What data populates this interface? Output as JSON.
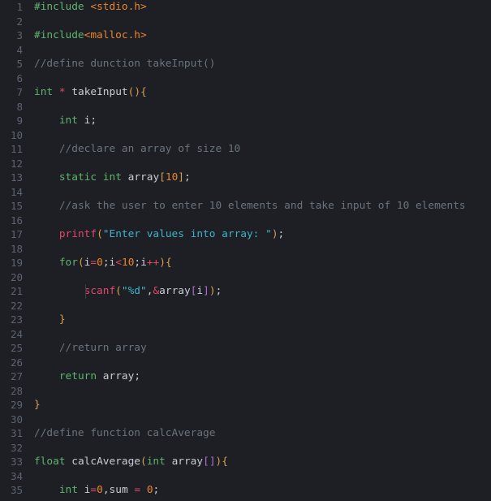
{
  "editor": {
    "language": "C",
    "background_color": "#1e1f25",
    "gutter_text_color": "#5c6370",
    "default_text_color": "#c8ccd4",
    "first_visible_line": 1,
    "last_visible_line": 35,
    "line_numbers": [
      "1",
      "2",
      "3",
      "4",
      "5",
      "6",
      "7",
      "8",
      "9",
      "10",
      "11",
      "12",
      "13",
      "14",
      "15",
      "16",
      "17",
      "18",
      "19",
      "20",
      "21",
      "22",
      "23",
      "24",
      "25",
      "26",
      "27",
      "28",
      "29",
      "30",
      "31",
      "32",
      "33",
      "34",
      "35"
    ],
    "plain_text": [
      "#include <stdio.h>",
      "",
      "#include<malloc.h>",
      "",
      "//define dunction takeInput()",
      "",
      "int * takeInput(){",
      "",
      "    int i;",
      "",
      "    //declare an array of size 10",
      "",
      "    static int array[10];",
      "",
      "    //ask the user to enter 10 elements and take input of 10 elements",
      "",
      "    printf(\"Enter values into array: \");",
      "",
      "    for(i=0;i<10;i++){",
      "",
      "        scanf(\"%d\",&array[i]);",
      "",
      "    }",
      "",
      "    //return array",
      "",
      "    return array;",
      "",
      "}",
      "",
      "//define function calcAverage",
      "",
      "float calcAverage(int array[]){",
      "",
      "    int i=0,sum = 0;"
    ],
    "lines": [
      {
        "n": "1",
        "tokens": [
          {
            "t": "#include",
            "c": "preproc"
          },
          {
            "t": " ",
            "c": "punct"
          },
          {
            "t": "<stdio.h>",
            "c": "header"
          }
        ]
      },
      {
        "n": "2",
        "tokens": []
      },
      {
        "n": "3",
        "tokens": [
          {
            "t": "#include",
            "c": "preproc"
          },
          {
            "t": "<malloc.h>",
            "c": "header"
          }
        ]
      },
      {
        "n": "4",
        "tokens": []
      },
      {
        "n": "5",
        "tokens": [
          {
            "t": "//define dunction takeInput()",
            "c": "comment"
          }
        ]
      },
      {
        "n": "6",
        "tokens": []
      },
      {
        "n": "7",
        "tokens": [
          {
            "t": "int",
            "c": "keyword"
          },
          {
            "t": " ",
            "c": "punct"
          },
          {
            "t": "*",
            "c": "op"
          },
          {
            "t": " ",
            "c": "punct"
          },
          {
            "t": "takeInput",
            "c": "ident"
          },
          {
            "t": "(",
            "c": "br1"
          },
          {
            "t": ")",
            "c": "br1"
          },
          {
            "t": "{",
            "c": "br1"
          }
        ]
      },
      {
        "n": "8",
        "tokens": []
      },
      {
        "n": "9",
        "tokens": [
          {
            "t": "    ",
            "c": "punct"
          },
          {
            "t": "int",
            "c": "keyword"
          },
          {
            "t": " ",
            "c": "punct"
          },
          {
            "t": "i",
            "c": "ident"
          },
          {
            "t": ";",
            "c": "punct"
          }
        ]
      },
      {
        "n": "10",
        "tokens": []
      },
      {
        "n": "11",
        "tokens": [
          {
            "t": "    ",
            "c": "punct"
          },
          {
            "t": "//declare an array of size 10",
            "c": "comment"
          }
        ]
      },
      {
        "n": "12",
        "tokens": []
      },
      {
        "n": "13",
        "tokens": [
          {
            "t": "    ",
            "c": "punct"
          },
          {
            "t": "static",
            "c": "keyword"
          },
          {
            "t": " ",
            "c": "punct"
          },
          {
            "t": "int",
            "c": "keyword"
          },
          {
            "t": " ",
            "c": "punct"
          },
          {
            "t": "array",
            "c": "ident"
          },
          {
            "t": "[",
            "c": "br1"
          },
          {
            "t": "10",
            "c": "number"
          },
          {
            "t": "]",
            "c": "br1"
          },
          {
            "t": ";",
            "c": "punct"
          }
        ]
      },
      {
        "n": "14",
        "tokens": []
      },
      {
        "n": "15",
        "tokens": [
          {
            "t": "    ",
            "c": "punct"
          },
          {
            "t": "//ask the user to enter 10 elements and take input of 10 elements",
            "c": "comment"
          }
        ]
      },
      {
        "n": "16",
        "tokens": []
      },
      {
        "n": "17",
        "tokens": [
          {
            "t": "    ",
            "c": "punct"
          },
          {
            "t": "printf",
            "c": "func"
          },
          {
            "t": "(",
            "c": "br1"
          },
          {
            "t": "\"Enter values into array: \"",
            "c": "string"
          },
          {
            "t": ")",
            "c": "br1"
          },
          {
            "t": ";",
            "c": "punct"
          }
        ]
      },
      {
        "n": "18",
        "tokens": []
      },
      {
        "n": "19",
        "tokens": [
          {
            "t": "    ",
            "c": "punct"
          },
          {
            "t": "for",
            "c": "keyword"
          },
          {
            "t": "(",
            "c": "br1"
          },
          {
            "t": "i",
            "c": "ident"
          },
          {
            "t": "=",
            "c": "op"
          },
          {
            "t": "0",
            "c": "number"
          },
          {
            "t": ";",
            "c": "punct"
          },
          {
            "t": "i",
            "c": "ident"
          },
          {
            "t": "<",
            "c": "op"
          },
          {
            "t": "10",
            "c": "number"
          },
          {
            "t": ";",
            "c": "punct"
          },
          {
            "t": "i",
            "c": "ident"
          },
          {
            "t": "++",
            "c": "op"
          },
          {
            "t": ")",
            "c": "br1"
          },
          {
            "t": "{",
            "c": "br1"
          }
        ]
      },
      {
        "n": "20",
        "tokens": []
      },
      {
        "n": "21",
        "tokens": [
          {
            "t": "        ",
            "c": "punct"
          },
          {
            "t": "scanf",
            "c": "func"
          },
          {
            "t": "(",
            "c": "br1"
          },
          {
            "t": "\"%d\"",
            "c": "string"
          },
          {
            "t": ",",
            "c": "punct"
          },
          {
            "t": "&",
            "c": "op"
          },
          {
            "t": "array",
            "c": "ident"
          },
          {
            "t": "[",
            "c": "br2"
          },
          {
            "t": "i",
            "c": "ident"
          },
          {
            "t": "]",
            "c": "br2"
          },
          {
            "t": ")",
            "c": "br1"
          },
          {
            "t": ";",
            "c": "punct"
          }
        ]
      },
      {
        "n": "22",
        "tokens": []
      },
      {
        "n": "23",
        "tokens": [
          {
            "t": "    ",
            "c": "punct"
          },
          {
            "t": "}",
            "c": "br1"
          }
        ]
      },
      {
        "n": "24",
        "tokens": []
      },
      {
        "n": "25",
        "tokens": [
          {
            "t": "    ",
            "c": "punct"
          },
          {
            "t": "//return array",
            "c": "comment"
          }
        ]
      },
      {
        "n": "26",
        "tokens": []
      },
      {
        "n": "27",
        "tokens": [
          {
            "t": "    ",
            "c": "punct"
          },
          {
            "t": "return",
            "c": "keyword"
          },
          {
            "t": " ",
            "c": "punct"
          },
          {
            "t": "array",
            "c": "ident"
          },
          {
            "t": ";",
            "c": "punct"
          }
        ]
      },
      {
        "n": "28",
        "tokens": []
      },
      {
        "n": "29",
        "tokens": [
          {
            "t": "}",
            "c": "br1"
          }
        ]
      },
      {
        "n": "30",
        "tokens": []
      },
      {
        "n": "31",
        "tokens": [
          {
            "t": "//define function calcAverage",
            "c": "comment"
          }
        ]
      },
      {
        "n": "32",
        "tokens": []
      },
      {
        "n": "33",
        "tokens": [
          {
            "t": "float",
            "c": "keyword"
          },
          {
            "t": " ",
            "c": "punct"
          },
          {
            "t": "calcAverage",
            "c": "ident"
          },
          {
            "t": "(",
            "c": "br1"
          },
          {
            "t": "int",
            "c": "keyword"
          },
          {
            "t": " ",
            "c": "punct"
          },
          {
            "t": "array",
            "c": "ident"
          },
          {
            "t": "[",
            "c": "br2"
          },
          {
            "t": "]",
            "c": "br2"
          },
          {
            "t": ")",
            "c": "br1"
          },
          {
            "t": "{",
            "c": "br1"
          }
        ]
      },
      {
        "n": "34",
        "tokens": []
      },
      {
        "n": "35",
        "tokens": [
          {
            "t": "    ",
            "c": "punct"
          },
          {
            "t": "int",
            "c": "keyword"
          },
          {
            "t": " ",
            "c": "punct"
          },
          {
            "t": "i",
            "c": "ident"
          },
          {
            "t": "=",
            "c": "op"
          },
          {
            "t": "0",
            "c": "number"
          },
          {
            "t": ",",
            "c": "punct"
          },
          {
            "t": "sum",
            "c": "ident"
          },
          {
            "t": " ",
            "c": "punct"
          },
          {
            "t": "=",
            "c": "op"
          },
          {
            "t": " ",
            "c": "punct"
          },
          {
            "t": "0",
            "c": "number"
          },
          {
            "t": ";",
            "c": "punct"
          }
        ]
      }
    ],
    "indent_guides": [
      {
        "line_start": "21",
        "line_end": "21",
        "indent_level": 1
      }
    ]
  }
}
